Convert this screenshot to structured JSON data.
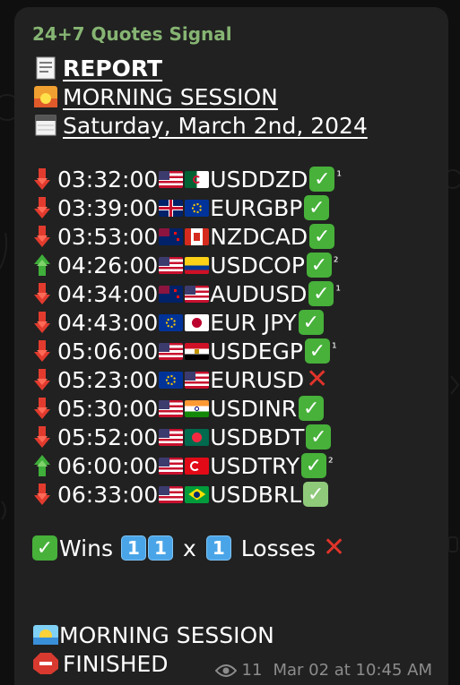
{
  "message": {
    "sender": "24+7 Quotes Signal",
    "header_lines": [
      {
        "icon": "receipt-icon",
        "text": "REPORT"
      },
      {
        "icon": "sunrise-icon",
        "text": "MORNING SESSION"
      },
      {
        "icon": "calendar-icon",
        "text": "Saturday,  March 2nd,  2024"
      }
    ],
    "signals": [
      {
        "time": "03:32:00",
        "pair": "USDDZD",
        "flag_a": "us",
        "flag_b": "dz",
        "direction": "down",
        "result": "win",
        "martingale": "¹"
      },
      {
        "time": "03:39:00",
        "pair": "EURGBP",
        "flag_a": "gb",
        "flag_b": "eu",
        "direction": "down",
        "result": "win",
        "martingale": ""
      },
      {
        "time": "03:53:00",
        "pair": "NZDCAD",
        "flag_a": "nz",
        "flag_b": "ca",
        "direction": "down",
        "result": "win",
        "martingale": ""
      },
      {
        "time": "04:26:00",
        "pair": "USDCOP",
        "flag_a": "us",
        "flag_b": "co",
        "direction": "up",
        "result": "win",
        "martingale": "²"
      },
      {
        "time": "04:34:00",
        "pair": "AUDUSD",
        "flag_a": "au",
        "flag_b": "us",
        "direction": "down",
        "result": "win",
        "martingale": "¹"
      },
      {
        "time": "04:43:00",
        "pair": "EUR JPY",
        "flag_a": "eu",
        "flag_b": "jp",
        "direction": "down",
        "result": "win",
        "martingale": ""
      },
      {
        "time": "05:06:00",
        "pair": "USDEGP",
        "flag_a": "us",
        "flag_b": "eg",
        "direction": "down",
        "result": "win",
        "martingale": "¹"
      },
      {
        "time": "05:23:00",
        "pair": "EURUSD",
        "flag_a": "eu",
        "flag_b": "us",
        "direction": "down",
        "result": "loss",
        "martingale": ""
      },
      {
        "time": "05:30:00",
        "pair": "USDINR",
        "flag_a": "us",
        "flag_b": "in",
        "direction": "down",
        "result": "win",
        "martingale": ""
      },
      {
        "time": "05:52:00",
        "pair": "USDBDT",
        "flag_a": "us",
        "flag_b": "bd",
        "direction": "down",
        "result": "win",
        "martingale": ""
      },
      {
        "time": "06:00:00",
        "pair": "USDTRY",
        "flag_a": "us",
        "flag_b": "tr",
        "direction": "up",
        "result": "win",
        "martingale": "²"
      },
      {
        "time": "06:33:00",
        "pair": "USDBRL",
        "flag_a": "us",
        "flag_b": "br",
        "direction": "down",
        "result": "win-pale",
        "martingale": ""
      }
    ],
    "summary": {
      "wins_label": "Wins",
      "wins_digits": [
        "1",
        "1"
      ],
      "times": "x",
      "losses_digits": [
        "1"
      ],
      "losses_label": "Losses"
    },
    "footer_lines": [
      {
        "icon": "sunset-icon",
        "text": "MORNING SESSION"
      },
      {
        "icon": "stop-sign-icon",
        "text": "FINISHED"
      }
    ],
    "meta": {
      "views": "11",
      "timestamp": "Mar 02 at 10:45 AM"
    }
  },
  "colors": {
    "bubble": "#212121",
    "sender": "#86b573",
    "win": "#47b13a",
    "loss": "#e0342a",
    "keycap": "#4aa5e8"
  }
}
